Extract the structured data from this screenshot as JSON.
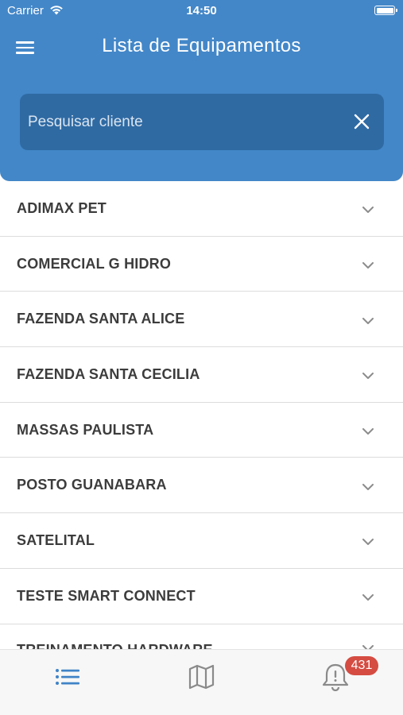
{
  "status_bar": {
    "carrier": "Carrier",
    "time": "14:50"
  },
  "header": {
    "title": "Lista de Equipamentos"
  },
  "search": {
    "placeholder": "Pesquisar cliente",
    "value": ""
  },
  "clients": [
    {
      "name": "ADIMAX PET"
    },
    {
      "name": "COMERCIAL G HIDRO"
    },
    {
      "name": "FAZENDA SANTA ALICE"
    },
    {
      "name": "FAZENDA SANTA CECILIA"
    },
    {
      "name": "MASSAS PAULISTA"
    },
    {
      "name": "POSTO GUANABARA"
    },
    {
      "name": "SATELITAL"
    },
    {
      "name": "TESTE SMART CONNECT"
    },
    {
      "name": "TREINAMENTO HARDWARE"
    }
  ],
  "tab_bar": {
    "tabs": [
      {
        "icon": "list-icon",
        "active": true
      },
      {
        "icon": "map-icon",
        "active": false
      },
      {
        "icon": "bell-alert-icon",
        "active": false
      }
    ],
    "notification_count": "431"
  },
  "colors": {
    "header_bg": "#4387c8",
    "search_bg": "#2f6aa3",
    "active_tab": "#3f83c7",
    "inactive_tab": "#8a8a8a",
    "badge": "#d54c42"
  }
}
